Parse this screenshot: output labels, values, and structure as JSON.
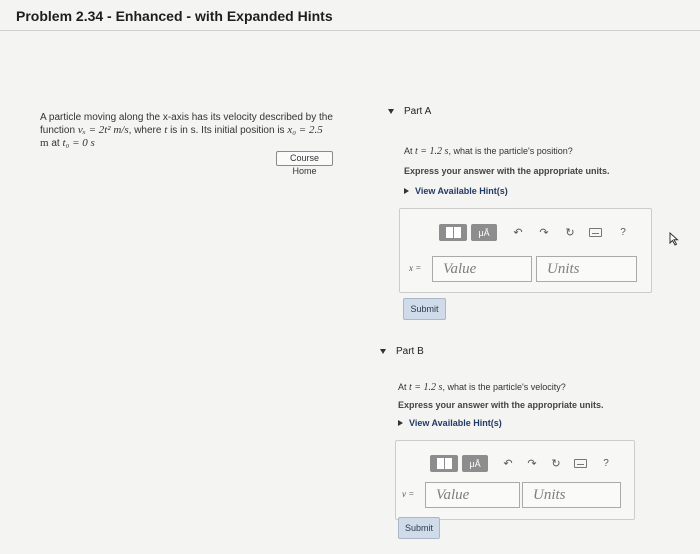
{
  "header": {
    "title": "Problem 2.34 - Enhanced - with Expanded Hints"
  },
  "problem": {
    "line1": "A particle moving along the x-axis has its velocity described by the",
    "line2_prefix": "function",
    "line2_formula": "vₓ = 2t² m/s",
    "line2_middle": ", where",
    "line2_var": "t",
    "line2_suffix": "is in s. Its initial position is",
    "line2_x0": "x₀ = 2.5",
    "line3_unit": "m",
    "line3_at": "at",
    "line3_t0": "t₀ = 0 s",
    "course_home_label": "Course Home"
  },
  "parts": [
    {
      "label": "Part A",
      "question_prefix": "At",
      "question_time": "t = 1.2 s",
      "question_suffix": ", what is the particle's position?",
      "express": "Express your answer with the appropriate units.",
      "hints_label": "View Available Hint(s)",
      "variable": "x =",
      "value_placeholder": "Value",
      "units_placeholder": "Units",
      "submit_label": "Submit"
    },
    {
      "label": "Part B",
      "question_prefix": "At",
      "question_time": "t = 1.2 s",
      "question_suffix": ", what is the particle's velocity?",
      "express": "Express your answer with the appropriate units.",
      "hints_label": "View Available Hint(s)",
      "variable": "v =",
      "value_placeholder": "Value",
      "units_placeholder": "Units",
      "submit_label": "Submit"
    }
  ],
  "toolbar": {
    "templates_icon": "templates-icon",
    "units_label": "μÅ",
    "undo_glyph": "↶",
    "redo_glyph": "↷",
    "reset_glyph": "↻",
    "keyboard_icon": "keyboard-icon",
    "help_glyph": "?"
  }
}
